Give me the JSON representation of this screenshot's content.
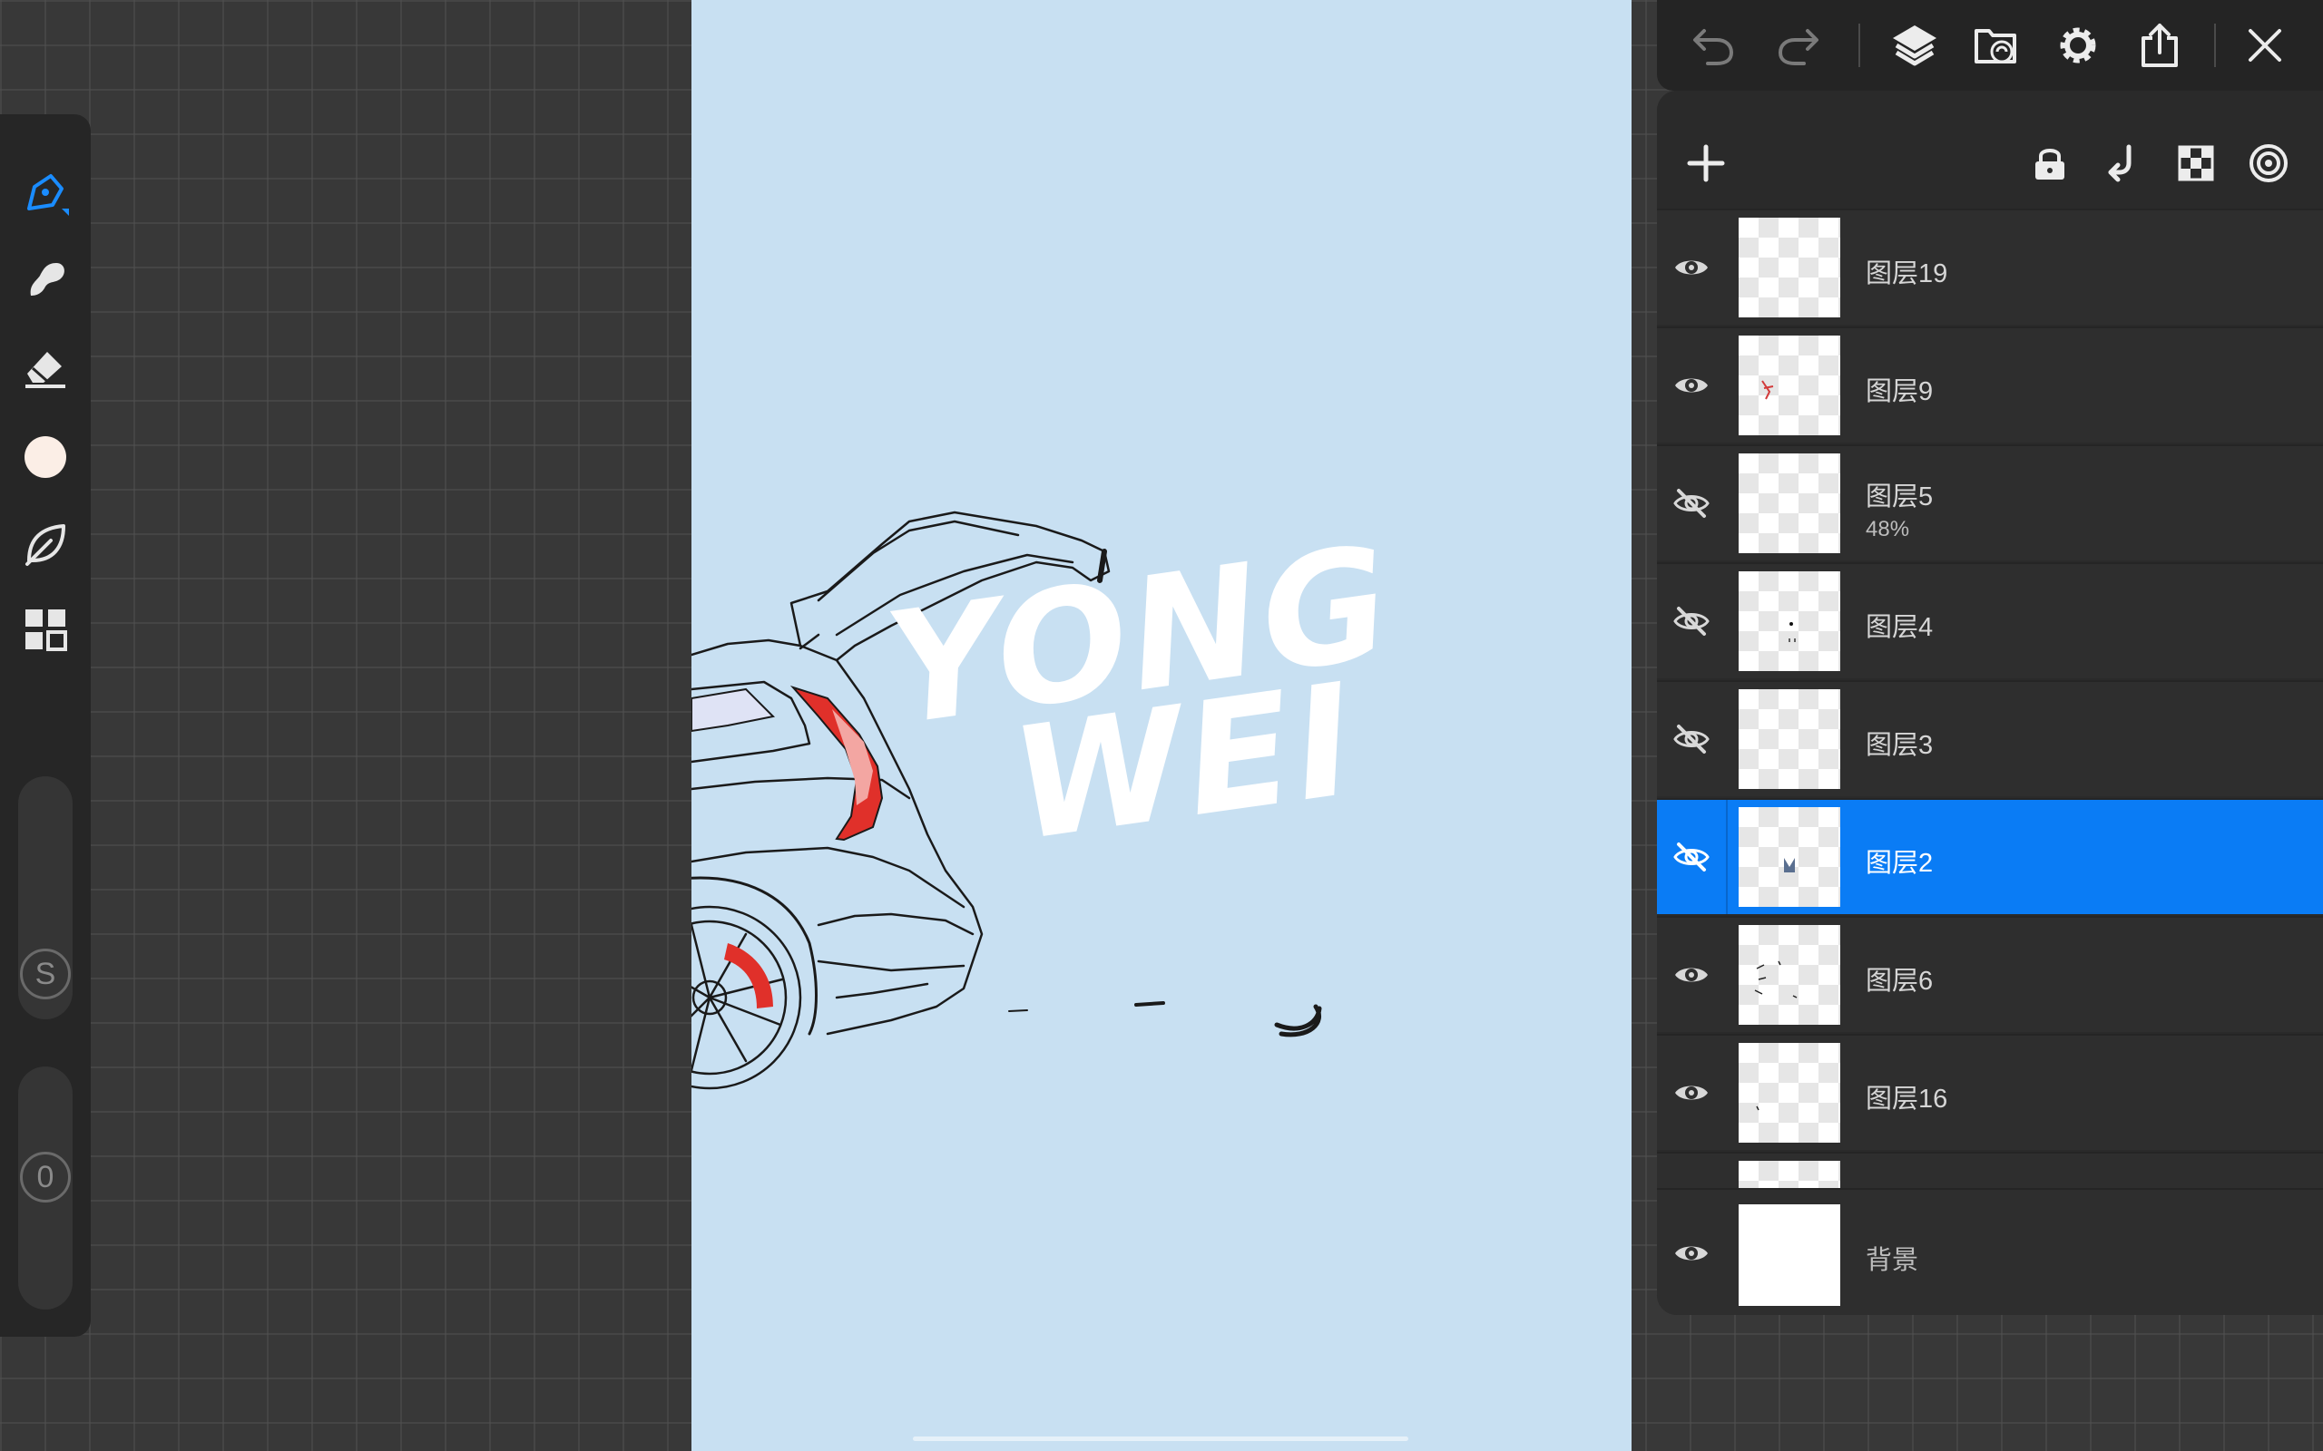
{
  "toolbar_top": {
    "buttons": [
      {
        "name": "undo-button",
        "icon": "undo-icon"
      },
      {
        "name": "redo-button",
        "icon": "redo-icon"
      },
      {
        "name": "layers-button",
        "icon": "layers-icon"
      },
      {
        "name": "reference-button",
        "icon": "folder-sync-icon"
      },
      {
        "name": "settings-button",
        "icon": "gear-icon"
      },
      {
        "name": "share-button",
        "icon": "share-icon"
      },
      {
        "name": "close-button",
        "icon": "close-icon"
      }
    ]
  },
  "left_tools": {
    "items": [
      "pen-icon",
      "smudge-icon",
      "eraser-icon",
      "color-swatch",
      "leaf-icon",
      "grid-icon"
    ],
    "active_color": "#fbeee6",
    "accent": "#1a8cff",
    "size_slider_label": "S",
    "opacity_slider_label": "0"
  },
  "canvas": {
    "background": "#c8e0f2",
    "text_line1": "YONG",
    "text_line2": "WEI"
  },
  "layers": {
    "header_buttons": [
      "add-icon",
      "lock-icon",
      "merge-down-icon",
      "checker-icon",
      "target-icon"
    ],
    "items": [
      {
        "name": "图层19",
        "visible": true,
        "opacity": ""
      },
      {
        "name": "图层9",
        "visible": true,
        "opacity": ""
      },
      {
        "name": "图层5",
        "visible": false,
        "opacity": "48%"
      },
      {
        "name": "图层4",
        "visible": false,
        "opacity": ""
      },
      {
        "name": "图层3",
        "visible": false,
        "opacity": ""
      },
      {
        "name": "图层2",
        "visible": false,
        "opacity": "",
        "selected": true
      },
      {
        "name": "图层6",
        "visible": true,
        "opacity": ""
      },
      {
        "name": "图层16",
        "visible": true,
        "opacity": ""
      }
    ],
    "background_layer": {
      "name": "背景",
      "visible": true
    }
  }
}
